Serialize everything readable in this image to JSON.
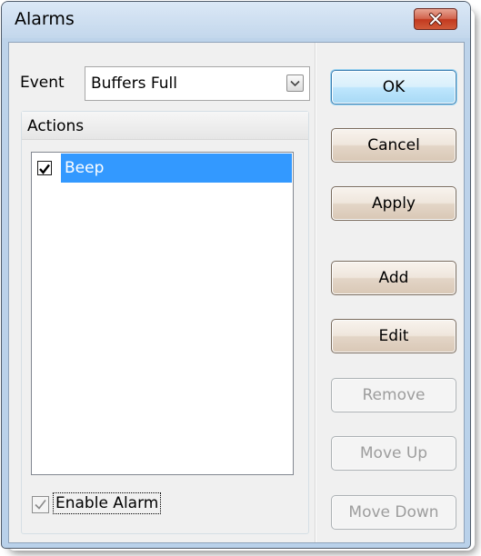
{
  "window": {
    "title": "Alarms"
  },
  "event": {
    "label": "Event",
    "selected": "Buffers Full"
  },
  "actions": {
    "title": "Actions",
    "items": [
      {
        "label": "Beep",
        "checked": true,
        "selected": true
      }
    ]
  },
  "enable_alarm": {
    "label": "Enable Alarm",
    "checked": true
  },
  "buttons": {
    "ok": "OK",
    "cancel": "Cancel",
    "apply": "Apply",
    "add": "Add",
    "edit": "Edit",
    "remove": "Remove",
    "move_up": "Move Up",
    "move_down": "Move Down"
  },
  "icons": {
    "close": "close-icon",
    "dropdown": "chevron-down-icon",
    "check": "checkmark-icon"
  },
  "colors": {
    "selection": "#3399ff",
    "close_button": "#c7452b",
    "title_bar": "#c3d7ec",
    "disabled_text": "#9d9d9d"
  }
}
